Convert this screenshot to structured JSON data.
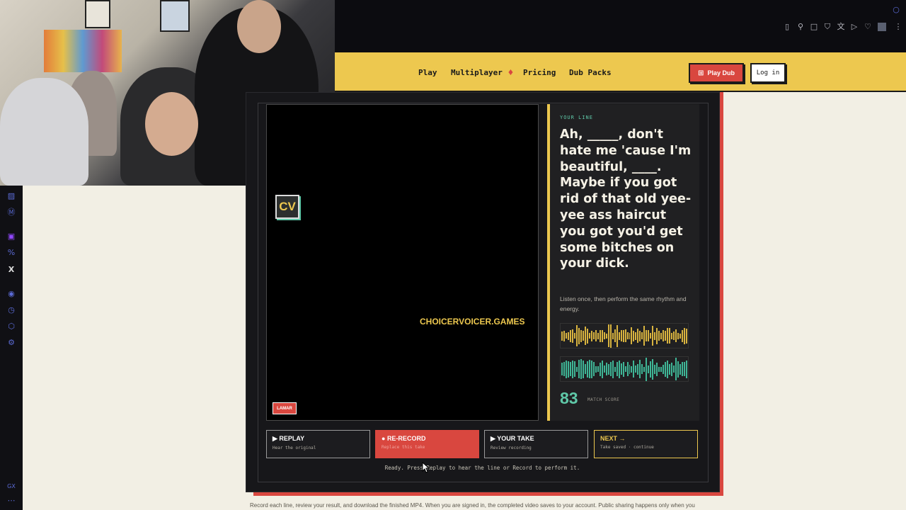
{
  "header": {
    "nav": [
      "Play",
      "Multiplayer",
      "Pricing",
      "Dub Packs"
    ],
    "multiplayer_icon": "fire-icon",
    "play_dub_label": "Play Dub",
    "login_label": "Log in"
  },
  "video": {
    "logo": "CV",
    "watermark": "CHOICERVOICER.GAMES",
    "character_tag": "LAMAR"
  },
  "line_panel": {
    "label": "YOUR LINE",
    "line": "Ah, _____, don't hate me 'cause I'm beautiful, ____. Maybe if you got rid of that old yee-yee ass haircut you got you'd get some bitches on your dick.",
    "hint": "Listen once, then perform the same rhythm and energy.",
    "match_score": "83",
    "match_label": "MATCH SCORE",
    "colors": {
      "original_wave": "#d8b33f",
      "take_wave": "#3fb596",
      "accent": "#edc84f"
    }
  },
  "actions": [
    {
      "title": "REPLAY",
      "subtitle": "Hear the original",
      "icon": "play-icon"
    },
    {
      "title": "RE-RECORD",
      "subtitle": "Replace this take",
      "icon": "record-dot-icon"
    },
    {
      "title": "YOUR TAKE",
      "subtitle": "Review recording",
      "icon": "play-icon"
    },
    {
      "title": "NEXT →",
      "subtitle": "Take saved · continue",
      "icon": ""
    }
  ],
  "status": "Ready. Press Replay to hear the line or Record to perform it.",
  "footer_note": "Record each line, review your result, and download the finished MP4. When you are signed in, the completed video saves to your account. Public sharing happens only when you"
}
